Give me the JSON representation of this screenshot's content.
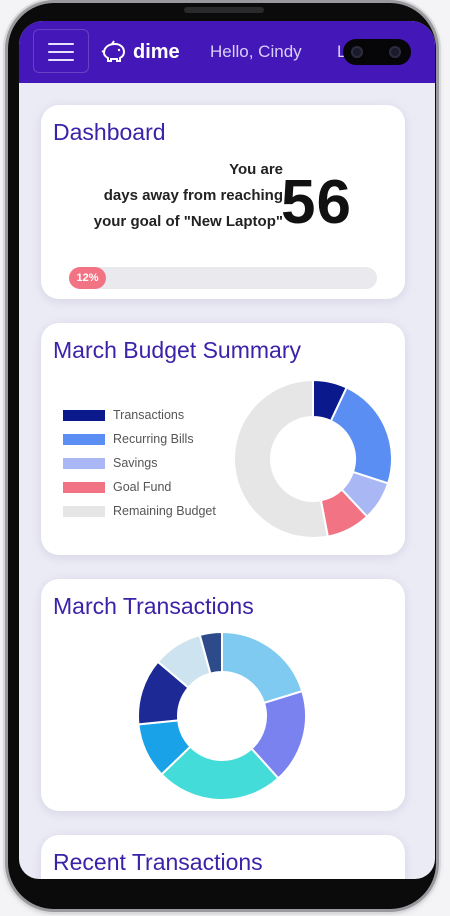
{
  "app": {
    "brand": "dime",
    "greeting": "Hello, Cindy",
    "nav_partial": "L"
  },
  "dashboard": {
    "title": "Dashboard",
    "goal_line1": "You are",
    "goal_line2": "days away from reaching",
    "goal_line3": "your goal of \"New Laptop\"",
    "days": "56",
    "progress_label": "12%",
    "progress_value": 12
  },
  "budget": {
    "title": "March Budget Summary",
    "legend": [
      {
        "label": "Transactions",
        "color": "#0a1a8c"
      },
      {
        "label": "Recurring Bills",
        "color": "#5a8ef2"
      },
      {
        "label": "Savings",
        "color": "#a9b7f4"
      },
      {
        "label": "Goal Fund",
        "color": "#f27484"
      },
      {
        "label": "Remaining Budget",
        "color": "#e6e6e6"
      }
    ]
  },
  "transactions_chart": {
    "title": "March Transactions"
  },
  "recent": {
    "title": "Recent Transactions"
  },
  "colors": {
    "navbar": "#4418b8",
    "accent_title": "#3b22a8",
    "progress": "#f27484"
  },
  "icons": {
    "menu": "hamburger-menu-icon",
    "logo": "piggy-bank-icon"
  },
  "chart_data": [
    {
      "type": "pie",
      "donut": true,
      "title": "March Budget Summary",
      "categories": [
        "Transactions",
        "Recurring Bills",
        "Savings",
        "Goal Fund",
        "Remaining Budget"
      ],
      "values": [
        7,
        23,
        8,
        9,
        53
      ],
      "colors": [
        "#0a1a8c",
        "#5a8ef2",
        "#a9b7f4",
        "#f27484",
        "#e6e6e6"
      ],
      "legend": "left"
    },
    {
      "type": "pie",
      "donut": true,
      "title": "March Transactions",
      "values": [
        19,
        17,
        23,
        10,
        12,
        9,
        4
      ],
      "colors": [
        "#7fcaf0",
        "#7a82f0",
        "#44dcd8",
        "#1aa2e8",
        "#1d2a95",
        "#cde4f0",
        "#2d4a8a"
      ]
    }
  ]
}
